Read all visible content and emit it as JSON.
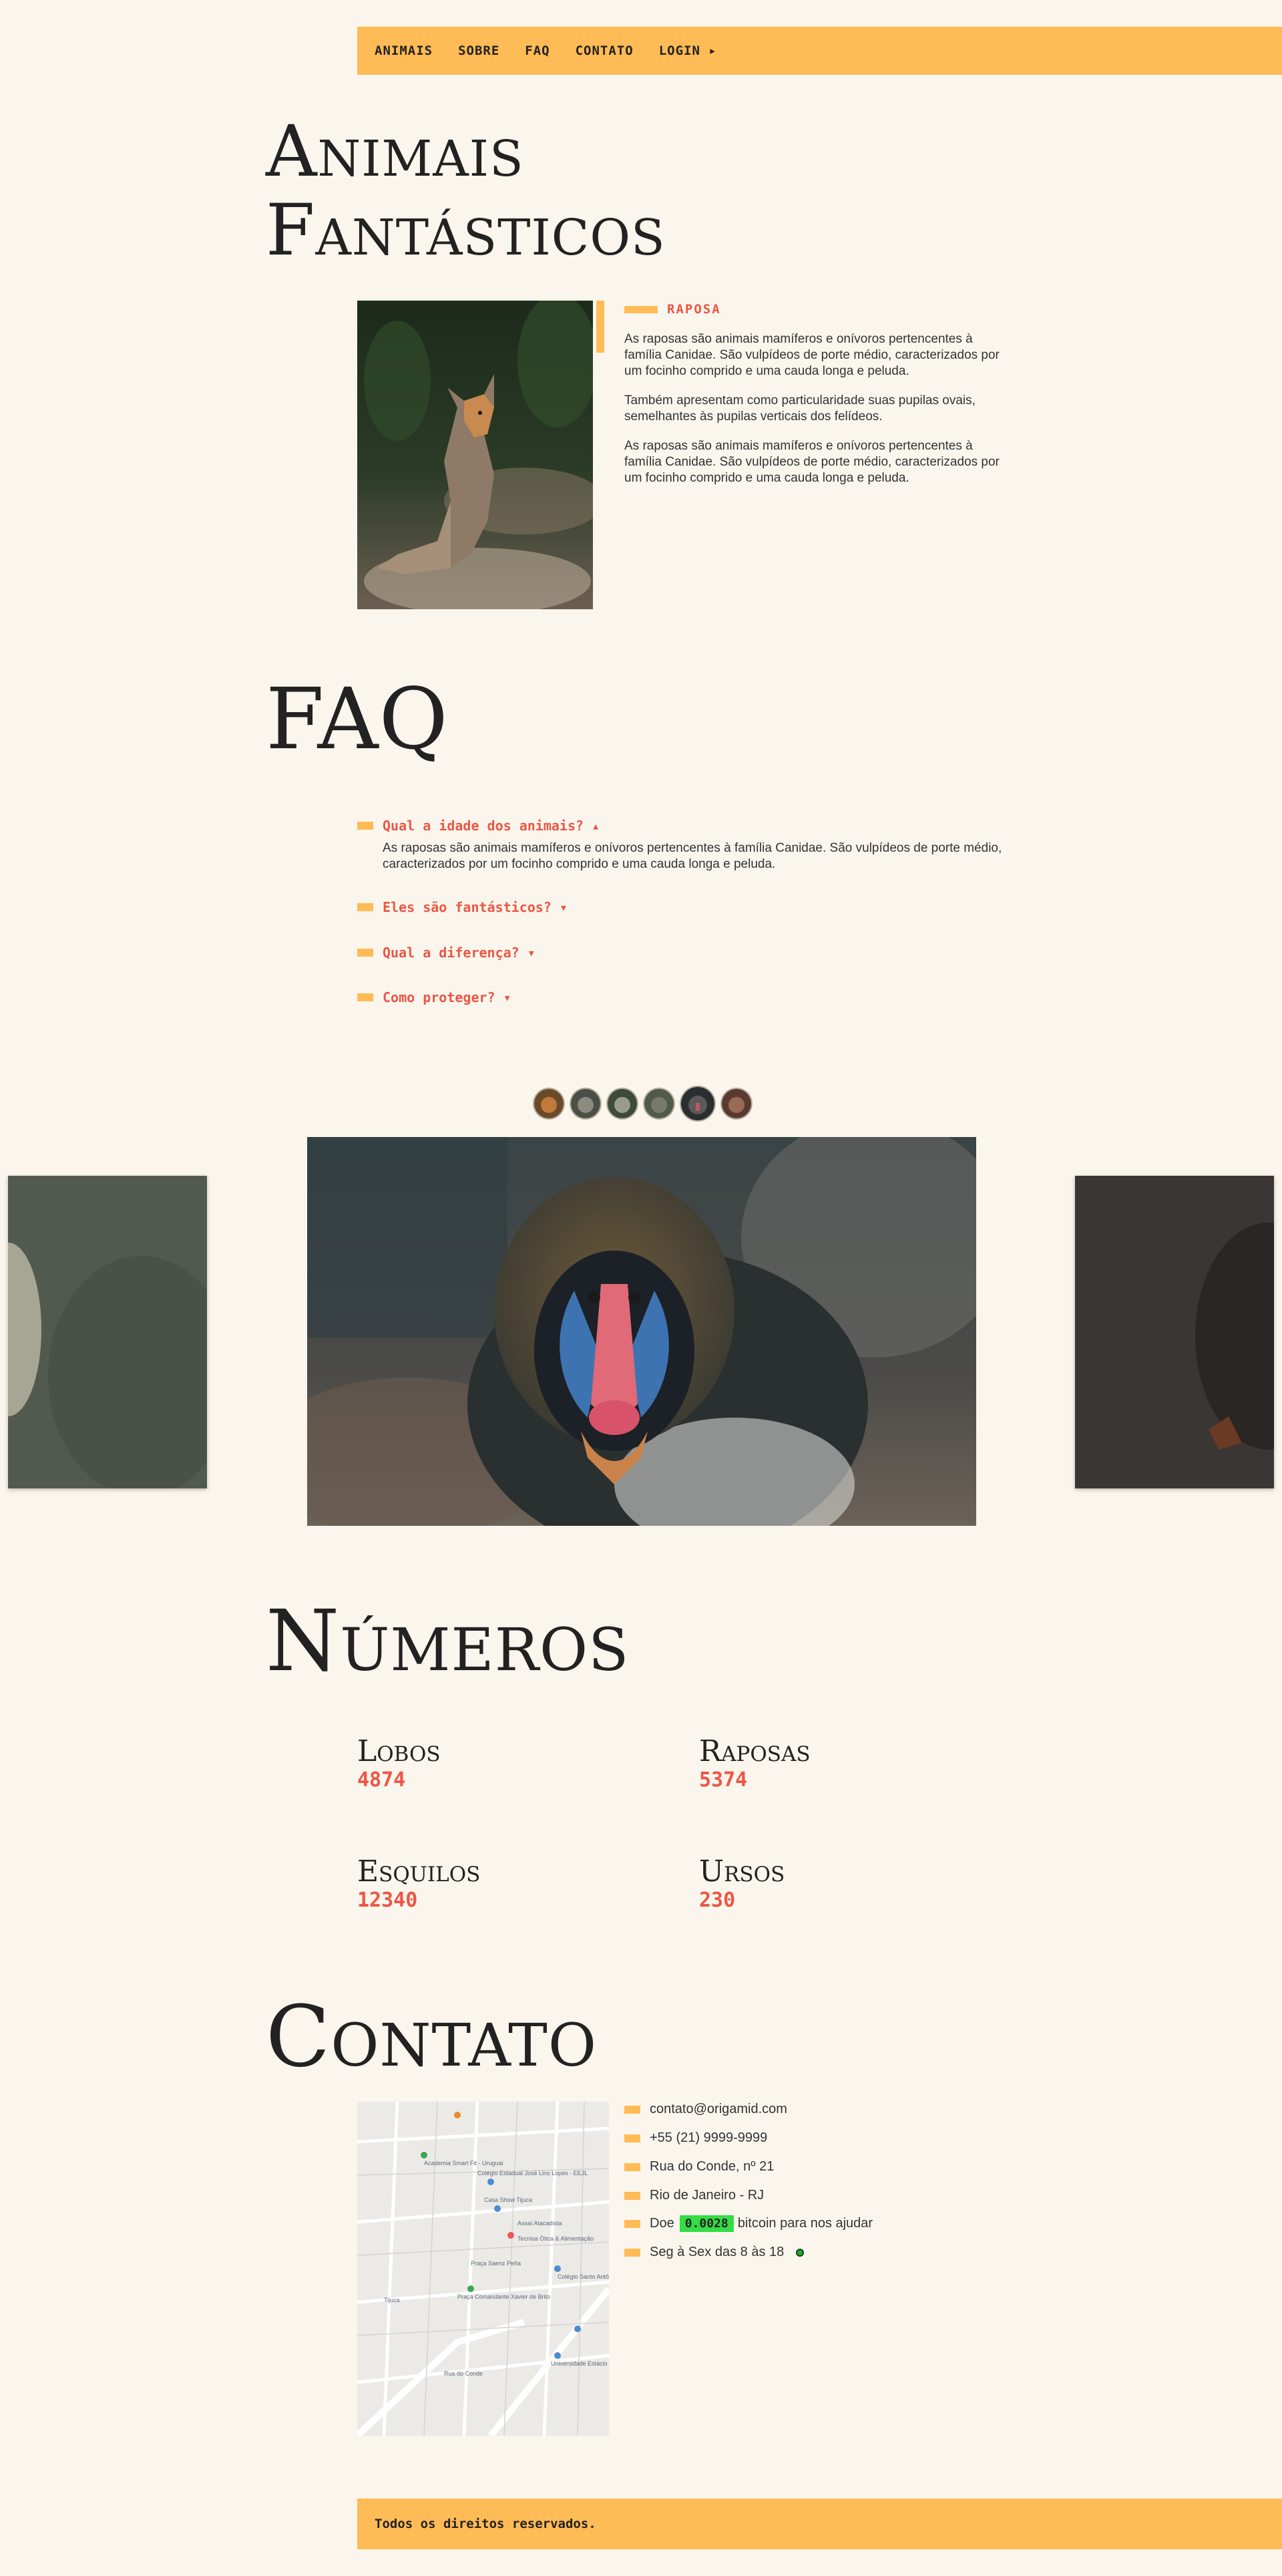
{
  "nav": {
    "items": [
      "ANIMAIS",
      "SOBRE",
      "FAQ",
      "CONTATO",
      "LOGIN ▸"
    ]
  },
  "hero": {
    "title_line1": "Animais",
    "title_line2": "Fantásticos",
    "animal_name": "RAPOSA",
    "paragraphs": [
      "As raposas são animais mamíferos e onívoros pertencentes à família Canidae. São vulpídeos de porte médio, caracterizados por um focinho comprido e uma cauda longa e peluda.",
      "Também apresentam como particularidade suas pupilas ovais, semelhantes às pupilas verticais dos felídeos.",
      "As raposas são animais mamíferos e onívoros pertencentes à família Canidae. São vulpídeos de porte médio, caracterizados por um focinho comprido e uma cauda longa e peluda."
    ]
  },
  "faq": {
    "title": "FAQ",
    "items": [
      {
        "question": "Qual a idade dos animais? ▴",
        "answer": "As raposas são animais mamíferos e onívoros pertencentes à família Canidae. São vulpídeos de porte médio, caracterizados por um focinho comprido e uma cauda longa e peluda."
      },
      {
        "question": "Eles são fantásticos? ▾"
      },
      {
        "question": "Qual a diferença? ▾"
      },
      {
        "question": "Como proteger? ▾"
      }
    ]
  },
  "numbers": {
    "title": "Números",
    "items": [
      {
        "label": "Lobos",
        "value": "4874"
      },
      {
        "label": "Raposas",
        "value": "5374"
      },
      {
        "label": "Esquilos",
        "value": "12340"
      },
      {
        "label": "Ursos",
        "value": "230"
      }
    ]
  },
  "contact": {
    "title": "Contato",
    "email": "contato@origamid.com",
    "phone": "+55 (21) 9999-9999",
    "address": "Rua do Conde, nº 21",
    "city": "Rio de Janeiro - RJ",
    "donate_prefix": "Doe",
    "btc_value": "0.0028",
    "donate_suffix": "bitcoin para nos ajudar",
    "hours": "Seg à Sex das 8 às 18"
  },
  "map": {
    "labels": [
      "Academia Smart Fit - Uruguai",
      "Colégio Estadual José Lins Lopes - EEJL",
      "Casa Show Tijuca",
      "Assaí Atacadista",
      "Tecnisa Ótica & Alimentação",
      "Praça Saenz Peña",
      "Praça Comandante Xavier de Brito",
      "Colégio Santo Antônio",
      "Universidade Estácio - Tijuca",
      "Rua do Conde",
      "Tijuca"
    ]
  },
  "footer": {
    "text": "Todos os direitos reservados."
  },
  "colors": {
    "accent": "#FFBB55",
    "highlight": "#E54",
    "background": "#FAF6ED",
    "btc": "#33DD44"
  }
}
